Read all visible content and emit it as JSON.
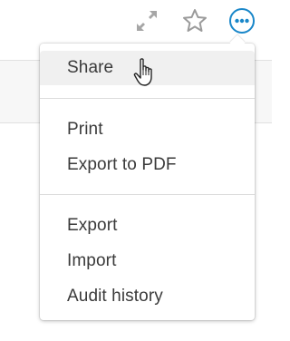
{
  "toolbar": {
    "icons": [
      "expand-icon",
      "star-icon",
      "more-icon"
    ],
    "accent_color": "#1a87c9",
    "icon_color": "#9b9b9b"
  },
  "menu": {
    "groups": [
      {
        "items": [
          {
            "label": "Share",
            "hovered": true
          }
        ]
      },
      {
        "items": [
          {
            "label": "Print"
          },
          {
            "label": "Export to PDF"
          }
        ]
      },
      {
        "items": [
          {
            "label": "Export"
          },
          {
            "label": "Import"
          },
          {
            "label": "Audit history"
          }
        ]
      }
    ]
  }
}
